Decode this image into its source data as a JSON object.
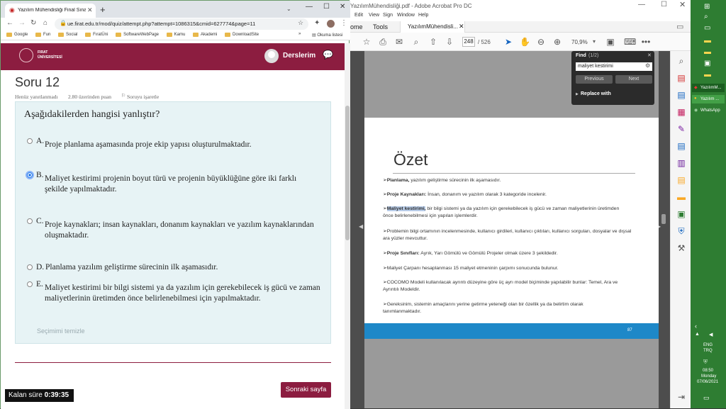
{
  "chrome": {
    "tab_title": "Yazılım Mühendisliği Final Sınav...",
    "url": "ue.firat.edu.tr/mod/quiz/attempt.php?attempt=1086315&cmid=627774&page=11",
    "bookmarks": [
      "Google",
      "Fun",
      "Social",
      "FıratÜni",
      "SoftwareWebPage",
      "Kamu",
      "Akademi",
      "DownloadSite"
    ],
    "reading_list": "Okuma listesi"
  },
  "moodle": {
    "logo_line1": "FIRAT",
    "logo_line2": "ÜNİVERSİTESİ",
    "user_menu": "Derslerim"
  },
  "question": {
    "title": "Soru 12",
    "status": "Henüz yanıtlanmadı",
    "points": "2.80 üzerinden puan",
    "flag": "Soruyu işaretle",
    "prompt": "Aşağıdakilerden hangisi yanlıştır?",
    "options": [
      {
        "letter": "A.",
        "text": "Proje planlama aşamasında proje ekip yapısı oluşturulmaktadır."
      },
      {
        "letter": "B.",
        "text": "Maliyet kestirimi projenin boyut türü ve projenin büyüklüğüne göre iki farklı şekilde yapılmaktadır."
      },
      {
        "letter": "C.",
        "text": "Proje kaynakları; insan kaynakları, donanım kaynakları ve yazılım kaynaklarından oluşmaktadır."
      },
      {
        "letter": "D.",
        "text": "Planlama yazılım geliştirme sürecinin ilk aşamasıdır."
      },
      {
        "letter": "E.",
        "text": "Maliyet kestirimi bir bilgi sistemi ya da yazılım için gerekebilecek iş gücü ve zaman maliyetlerinin üretimden önce belirlenebilmesi için yapılmaktadır."
      }
    ],
    "selected": "B",
    "clear": "Seçimimi temizle",
    "next": "Sonraki sayfa",
    "timer_label": "Kalan süre",
    "timer": "0:39:35"
  },
  "acrobat": {
    "title": "YazılımMühendisliği.pdf - Adobe Acrobat Pro DC",
    "menu": [
      "Edit",
      "View",
      "Sign",
      "Window",
      "Help"
    ],
    "tabs": [
      "ome",
      "Tools",
      "YazılımMühendisli..."
    ],
    "page_current": "248",
    "page_total": "/ 526",
    "zoom": "70,9%",
    "find": {
      "title": "Find",
      "count": "(1/2)",
      "query": "maliyet kestirimi",
      "prev": "Previous",
      "next": "Next",
      "replace": "Replace with"
    },
    "pdf": {
      "heading": "Özet",
      "page_num": "87",
      "bullets": [
        {
          "b": "Planlama,",
          "t": " yazılım geliştirme sürecinin ilk aşamasıdır."
        },
        {
          "b": "Proje Kaynakları:",
          "t": " İnsan, donanım ve yazılım olarak 3 kategoride incelenir."
        },
        {
          "b": "Maliyet kestirimi,",
          "t": " bir bilgi sistemi ya da yazılım için gerekebilecek iş gücü ve zaman maliyetlerinin üretimden önce belirlenebilmesi için yapılan işlemlerdir."
        },
        {
          "b": "",
          "t": "Problemin bilgi ortamının incelenmesinde, kullanıcı girdileri, kullanıcı çıktıları, kullanıcı sorguları, dosyalar ve dışsal ara yüzler mevcuttur."
        },
        {
          "b": "Proje Sınıfları:",
          "t": " Ayrık, Yarı Gömülü ve Gömülü Projeler olmak üzere 3 şekildedir."
        },
        {
          "b": "",
          "t": "Maliyet Çarpanı hesaplanması 15 maliyet etmeninin çarpımı sonucunda bulunur."
        },
        {
          "b": "",
          "t": "COCOMO Modeli kullanılacak ayrıntı düzeyine göre üç ayrı model biçiminde yapılabilir bunlar: Temel, Ara ve Ayrıntılı Modeldir."
        },
        {
          "b": "",
          "t": "Gereksinim, sistemin amaçlarını yerine getirme yeteneği olan bir özellik ya da belirtim olarak tanımlanmaktadır."
        }
      ]
    }
  },
  "taskbar": {
    "apps": [
      "YazılımM...",
      "Yazılım ...",
      "WhatsApp"
    ],
    "lang1": "ENG",
    "lang2": "TRQ",
    "time": "08:50",
    "day": "Monday",
    "date": "07/06/2021"
  }
}
